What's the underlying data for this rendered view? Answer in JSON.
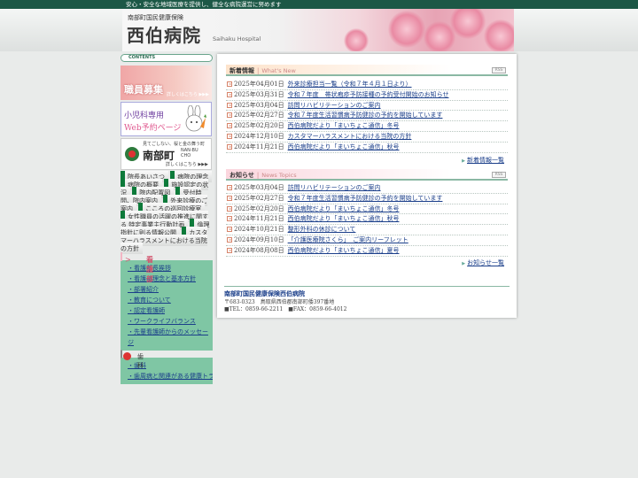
{
  "topbar": {
    "tagline": "安心・安全な地域医療を提供し、健全な病院運営に努めます"
  },
  "header": {
    "subtitle": "南部町国民健康保険",
    "title": "西伯病院",
    "title_en": "Saihaku Hospital"
  },
  "sidebar": {
    "contents_label": "CONTENTS",
    "banners": {
      "recruit": {
        "title": "職員募集",
        "more": "詳しくはこちら ▶▶▶"
      },
      "pediatrics": {
        "line1": "小児科専用",
        "line2": "Web予約ページ"
      },
      "town": {
        "caption": "見てごしない、桜と金の舞う町",
        "name": "南部町",
        "name_en_1": "NAN-BU",
        "name_en_2": "CHO",
        "more": "詳しくはこちら ▶▶▶"
      }
    },
    "nav": [
      "院長あいさつ",
      "病院の理念",
      "病院の概要",
      "施設認定の状況",
      "院内配置図",
      "受付時間、院内案内",
      "外来診療のご案内",
      "こころの巡回診療室",
      "女性職員の活躍の推進に関する 特定事業主行動計画",
      "倫理指針に則る情報公開",
      "カスタマーハラスメントにおける当院の方針"
    ],
    "nursing": {
      "heading": "看護部",
      "items": [
        "看護部長挨拶",
        "看護部理念と基本方針",
        "部署紹介",
        "教育について",
        "認定看護師",
        "ワークライフバランス",
        "先輩看護師からのメッセージ"
      ]
    },
    "dental": {
      "heading": "歯科",
      "items": [
        "歯科",
        "歯周病と関連がある健康トラブ"
      ]
    }
  },
  "news": {
    "title": "新着情報",
    "title_en": "What's New",
    "rss": "RSS",
    "items": [
      {
        "date": "2025年04月01日",
        "text": "外来診療担当一覧（令和７年４月１日より）"
      },
      {
        "date": "2025年03月31日",
        "text": "令和７年度　帯状疱疹予防接種の予約受付開始のお知らせ"
      },
      {
        "date": "2025年03月04日",
        "text": "訪問リハビリテーションのご案内"
      },
      {
        "date": "2025年02月27日",
        "text": "令和７年度生活習慣病予防健診の予約を開始しています"
      },
      {
        "date": "2025年02月20日",
        "text": "西伯病院だより「まいちょこ通信」冬号"
      },
      {
        "date": "2024年12月10日",
        "text": "カスタマーハラスメントにおける当院の方針"
      },
      {
        "date": "2024年11月21日",
        "text": "西伯病院だより「まいちょこ通信」秋号"
      }
    ],
    "more": "新着情報一覧"
  },
  "topics": {
    "title": "お知らせ",
    "title_en": "News Topics",
    "rss": "RSS",
    "items": [
      {
        "date": "2025年03月04日",
        "text": "訪問リハビリテーションのご案内"
      },
      {
        "date": "2025年02月27日",
        "text": "令和７年度生活習慣病予防健診の予約を開始しています"
      },
      {
        "date": "2025年02月20日",
        "text": "西伯病院だより「まいちょこ通信」冬号"
      },
      {
        "date": "2024年11月21日",
        "text": "西伯病院だより「まいちょこ通信」秋号"
      },
      {
        "date": "2024年10月21日",
        "text": "整形外科の休診について"
      },
      {
        "date": "2024年09月10日",
        "text": "「介護医療院さくら」　ご案内リーフレット"
      },
      {
        "date": "2024年08月08日",
        "text": "西伯病院だより「まいちょこ通信」夏号"
      }
    ],
    "more": "お知らせ一覧"
  },
  "footer": {
    "name": "南部町国民健康保険西伯病院",
    "address": "〒683-0323　鳥取県西伯郡南部町倭397番地",
    "tel": "■TEL：0859-66-2211　■FAX：0859-66-4012"
  },
  "colors": {
    "topbar": "#1c5846",
    "nav_accent": "#0d7a3a",
    "link": "#1b3f8a",
    "nursing_bg": "#7fc6a4"
  }
}
